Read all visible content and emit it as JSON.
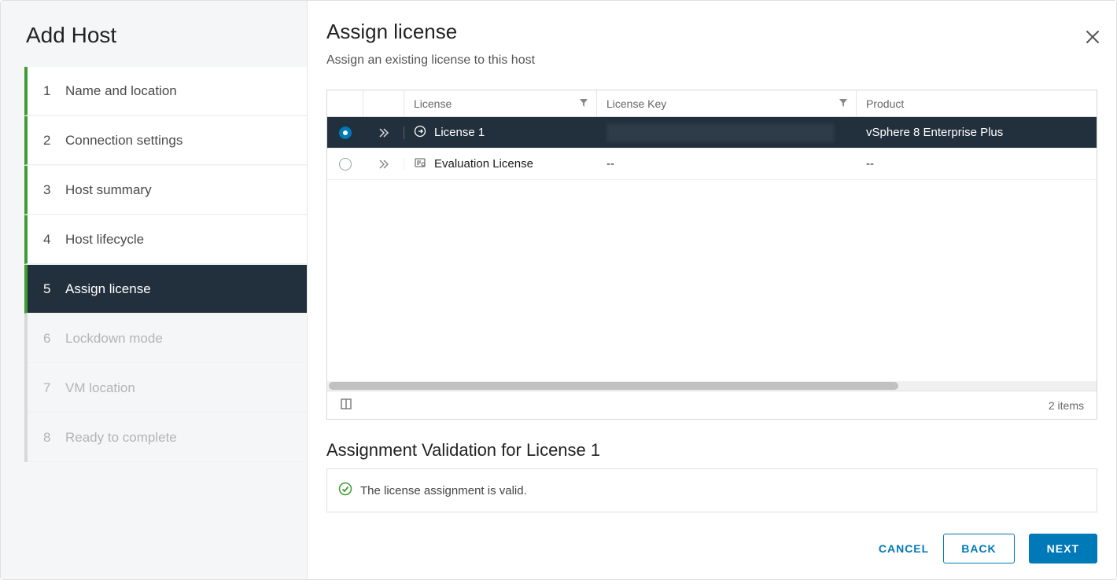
{
  "sidebar": {
    "title": "Add Host",
    "steps": [
      {
        "num": "1",
        "label": "Name and location",
        "state": "completed"
      },
      {
        "num": "2",
        "label": "Connection settings",
        "state": "completed"
      },
      {
        "num": "3",
        "label": "Host summary",
        "state": "completed"
      },
      {
        "num": "4",
        "label": "Host lifecycle",
        "state": "completed"
      },
      {
        "num": "5",
        "label": "Assign license",
        "state": "active"
      },
      {
        "num": "6",
        "label": "Lockdown mode",
        "state": "future"
      },
      {
        "num": "7",
        "label": "VM location",
        "state": "future"
      },
      {
        "num": "8",
        "label": "Ready to complete",
        "state": "future"
      }
    ]
  },
  "main": {
    "title": "Assign license",
    "subtitle": "Assign an existing license to this host"
  },
  "table": {
    "columns": {
      "license": "License",
      "key": "License Key",
      "product": "Product"
    },
    "rows": [
      {
        "selected": true,
        "name": "License 1",
        "key_hidden": true,
        "key_text": "",
        "product": "vSphere 8 Enterprise Plus"
      },
      {
        "selected": false,
        "name": "Evaluation License",
        "key_hidden": false,
        "key_text": "--",
        "product": "--"
      }
    ],
    "footer_count": "2 items"
  },
  "validation": {
    "title": "Assignment Validation for License 1",
    "message": "The license assignment is valid."
  },
  "footer": {
    "cancel": "CANCEL",
    "back": "BACK",
    "next": "NEXT"
  }
}
